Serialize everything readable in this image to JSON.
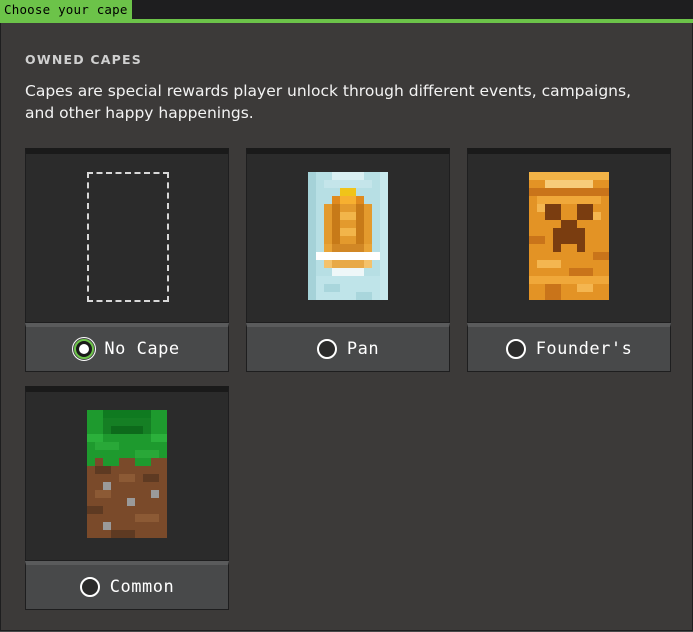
{
  "window": {
    "title": "Choose your cape"
  },
  "section": {
    "heading": "OWNED CAPES",
    "description": "Capes are special rewards player unlock through different events, campaigns, and other happy happenings."
  },
  "capes": [
    {
      "label": "No Cape",
      "selected": true,
      "icon": "empty-cape-outline"
    },
    {
      "label": "Pan",
      "selected": false,
      "icon": "pan-cape"
    },
    {
      "label": "Founder's",
      "selected": false,
      "icon": "founders-cape"
    },
    {
      "label": "Common",
      "selected": false,
      "icon": "common-cape"
    }
  ],
  "colors": {
    "accent": "#6cc349",
    "panel": "#3c3a39",
    "card_preview": "#2b2b2b",
    "card_label": "#48494a"
  }
}
